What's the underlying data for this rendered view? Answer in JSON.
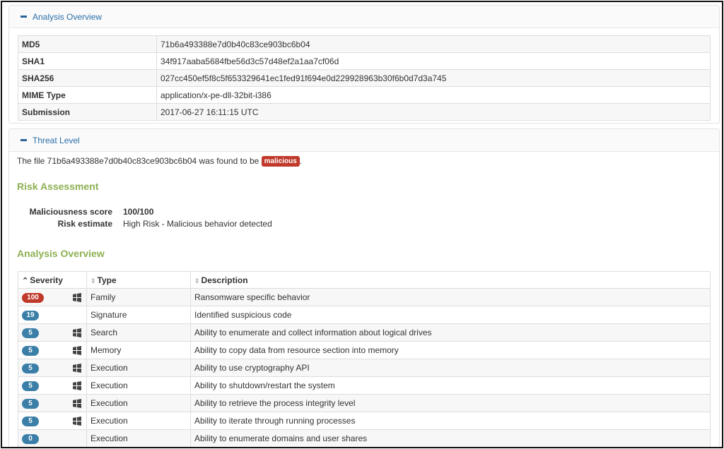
{
  "analysis_overview_panel": {
    "title": "Analysis Overview",
    "rows": [
      {
        "key": "MD5",
        "value": "71b6a493388e7d0b40c83ce903bc6b04"
      },
      {
        "key": "SHA1",
        "value": "34f917aaba5684fbe56d3c57d48ef2a1aa7cf06d"
      },
      {
        "key": "SHA256",
        "value": "027cc450ef5f8c5f653329641ec1fed91f694e0d229928963b30f6b0d7d3a745"
      },
      {
        "key": "MIME Type",
        "value": "application/x-pe-dll-32bit-i386"
      },
      {
        "key": "Submission",
        "value": "2017-06-27 16:11:15 UTC"
      }
    ]
  },
  "threat_panel": {
    "title": "Threat Level",
    "verdict_prefix": "The file 71b6a493388e7d0b40c83ce903bc6b04 was found to be",
    "verdict_badge": "malicious",
    "verdict_suffix": ".",
    "risk_title": "Risk Assessment",
    "risk": {
      "score_label": "Maliciousness score",
      "score_value": "100/100",
      "estimate_label": "Risk estimate",
      "estimate_value": "High Risk - Malicious behavior detected"
    },
    "overview_title": "Analysis Overview",
    "table": {
      "headers": {
        "severity": "Severity",
        "type": "Type",
        "description": "Description"
      },
      "rows": [
        {
          "severity": "100",
          "type": "Family",
          "description": "Ransomware specific behavior"
        },
        {
          "severity": "19",
          "type": "Signature",
          "description": "Identified suspicious code"
        },
        {
          "severity": "5",
          "type": "Search",
          "description": "Ability to enumerate and collect information about logical drives"
        },
        {
          "severity": "5",
          "type": "Memory",
          "description": "Ability to copy data from resource section into memory"
        },
        {
          "severity": "5",
          "type": "Execution",
          "description": "Ability to use cryptography API"
        },
        {
          "severity": "5",
          "type": "Execution",
          "description": "Ability to shutdown/restart the system"
        },
        {
          "severity": "5",
          "type": "Execution",
          "description": "Ability to retrieve the process integrity level"
        },
        {
          "severity": "5",
          "type": "Execution",
          "description": "Ability to iterate through running processes"
        },
        {
          "severity": "0",
          "type": "Execution",
          "description": "Ability to enumerate domains and user shares"
        }
      ]
    }
  },
  "icons": {
    "collapse": "minus-icon",
    "sort_active": "chevron-up-icon",
    "sort_inactive": "sort-icon",
    "os": "windows-icon"
  },
  "colors": {
    "link": "#2a6fa8",
    "section_title": "#8db052",
    "badge_red": "#c0392b",
    "badge_blue": "#3b7fa8"
  }
}
